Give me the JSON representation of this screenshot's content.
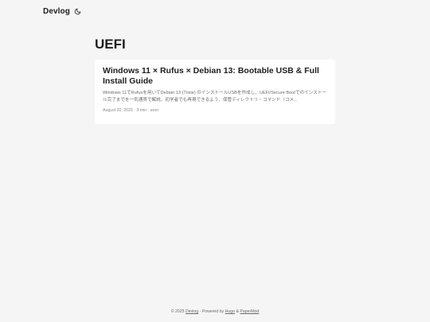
{
  "header": {
    "logo": "Devlog",
    "theme_icon": "moon-icon"
  },
  "main": {
    "title": "UEFI",
    "posts": [
      {
        "title": "Windows 11 × Rufus × Debian 13: Bootable USB & Full Install Guide",
        "summary": "Windows 11でRufusを用いてDebian 13 (Trixie) のインストールUSBを作成し、UEFI/Secure Bootでのインストール完了までを一気通貫で解説。初学者でも再現できるよう、保管ディレクトリ・コマンド（コメ...",
        "date": "August 20, 2025",
        "read_time": "3 min",
        "author": "aron"
      }
    ]
  },
  "footer": {
    "copyright": "© 2025",
    "site_link": "Devlog",
    "powered_by": "· Powered by",
    "hugo_link": "Hugo",
    "amp": "&",
    "theme_link": "PaperMod"
  }
}
